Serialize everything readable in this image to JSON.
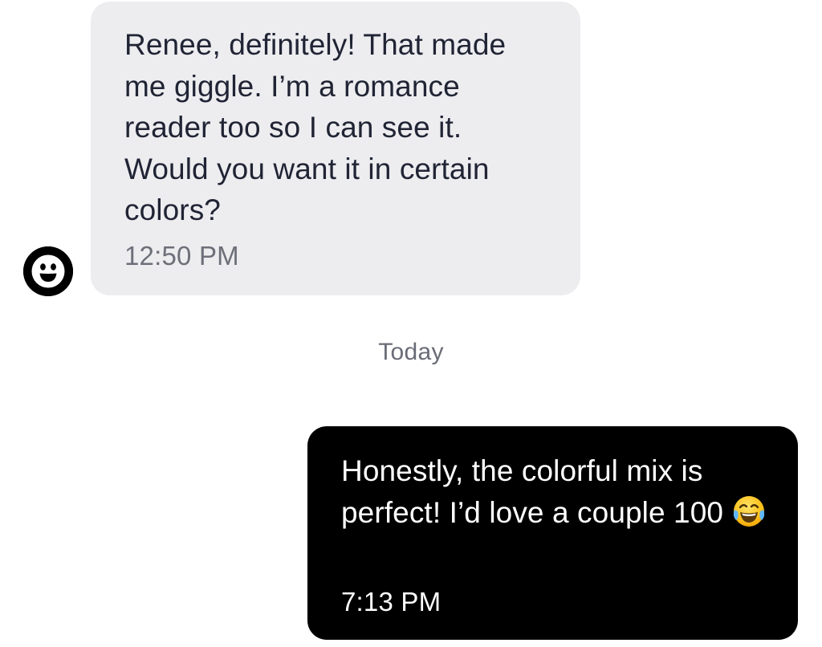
{
  "conversation": {
    "incoming": {
      "avatar_icon": "smiley-face-avatar-icon",
      "text": "Renee, definitely! That made me giggle. I’m a romance reader too so I can see it. Would you want it in certain colors?",
      "time": "12:50 PM",
      "bubble_color": "#ededf0",
      "text_color": "#202434"
    },
    "divider": {
      "label": "Today"
    },
    "outgoing": {
      "text": "Honestly, the colorful mix is perfect! I’d love a couple 100",
      "emoji": "face-with-tears-of-joy-emoji",
      "time": "7:13 PM",
      "bubble_color": "#000000",
      "text_color": "#ffffff"
    }
  }
}
